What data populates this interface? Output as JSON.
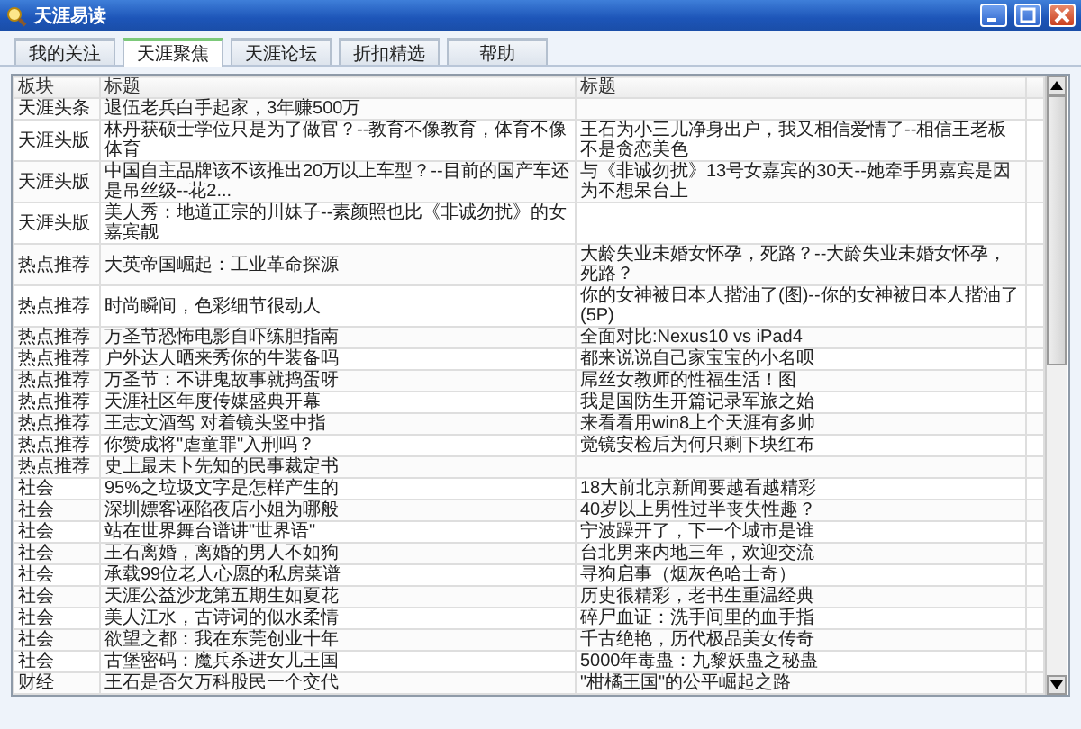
{
  "window": {
    "title": "天涯易读"
  },
  "tabs": [
    {
      "label": "我的关注",
      "selected": false
    },
    {
      "label": "天涯聚焦",
      "selected": true
    },
    {
      "label": "天涯论坛",
      "selected": false
    },
    {
      "label": "折扣精选",
      "selected": false
    },
    {
      "label": "帮助",
      "selected": false
    }
  ],
  "table": {
    "columns": [
      "板块",
      "标题",
      "标题"
    ],
    "rows": [
      {
        "section": "天涯头条",
        "title": "退伍老兵白手起家，3年赚500万",
        "title_2": ""
      },
      {
        "section": "天涯头版",
        "title": "林丹获硕士学位只是为了做官？--教育不像教育，体育不像体育",
        "title_2": "王石为小三儿净身出户，我又相信爱情了--相信王老板不是贪恋美色"
      },
      {
        "section": "天涯头版",
        "title": "中国自主品牌该不该推出20万以上车型？--目前的国产车还是吊丝级--花2...",
        "title_2": "与《非诚勿扰》13号女嘉宾的30天--她牵手男嘉宾是因为不想呆台上"
      },
      {
        "section": "天涯头版",
        "title": "美人秀：地道正宗的川妹子--素颜照也比《非诚勿扰》的女嘉宾靓",
        "title_2": ""
      },
      {
        "section": "热点推荐",
        "title": "大英帝国崛起：工业革命探源",
        "title_2": "大龄失业未婚女怀孕，死路？--大龄失业未婚女怀孕，死路？"
      },
      {
        "section": "热点推荐",
        "title": "时尚瞬间，色彩细节很动人",
        "title_2": "你的女神被日本人揩油了(图)--你的女神被日本人揩油了(5P)"
      },
      {
        "section": "热点推荐",
        "title": "万圣节恐怖电影自吓练胆指南",
        "title_2": "全面对比:Nexus10 vs iPad4"
      },
      {
        "section": "热点推荐",
        "title": "户外达人晒来秀你的牛装备吗",
        "title_2": "都来说说自己家宝宝的小名呗"
      },
      {
        "section": "热点推荐",
        "title": "万圣节：不讲鬼故事就捣蛋呀",
        "title_2": "屌丝女教师的性福生活！图"
      },
      {
        "section": "热点推荐",
        "title": "天涯社区年度传媒盛典开幕",
        "title_2": "我是国防生开篇记录军旅之始"
      },
      {
        "section": "热点推荐",
        "title": "王志文酒驾 对着镜头竖中指",
        "title_2": "来看看用win8上个天涯有多帅"
      },
      {
        "section": "热点推荐",
        "title": "你赞成将\"虐童罪\"入刑吗？",
        "title_2": "觉镜安检后为何只剩下块红布"
      },
      {
        "section": "热点推荐",
        "title": "史上最未卜先知的民事裁定书",
        "title_2": ""
      },
      {
        "section": "社会",
        "title": "95%之垃圾文字是怎样产生的",
        "title_2": "18大前北京新闻要越看越精彩"
      },
      {
        "section": "社会",
        "title": "深圳嫖客诬陷夜店小姐为哪般",
        "title_2": "40岁以上男性过半丧失性趣？"
      },
      {
        "section": "社会",
        "title": "站在世界舞台谱讲\"世界语\"",
        "title_2": "宁波躁开了，下一个城市是谁"
      },
      {
        "section": "社会",
        "title": "王石离婚，离婚的男人不如狗",
        "title_2": "台北男来内地三年，欢迎交流"
      },
      {
        "section": "社会",
        "title": "承载99位老人心愿的私房菜谱",
        "title_2": "寻狗启事（烟灰色哈士奇）"
      },
      {
        "section": "社会",
        "title": "天涯公益沙龙第五期生如夏花",
        "title_2": "历史很精彩，老书生重温经典"
      },
      {
        "section": "社会",
        "title": "美人江水，古诗词的似水柔情",
        "title_2": "碎尸血证：洗手间里的血手指"
      },
      {
        "section": "社会",
        "title": "欲望之都：我在东莞创业十年",
        "title_2": "千古绝艳，历代极品美女传奇"
      },
      {
        "section": "社会",
        "title": "古堡密码：魔兵杀进女儿王国",
        "title_2": "5000年毒蛊：九黎妖蛊之秘蛊"
      },
      {
        "section": "财经",
        "title": "王石是否欠万科股民一个交代",
        "title_2": "\"柑橘王国\"的公平崛起之路"
      }
    ]
  }
}
